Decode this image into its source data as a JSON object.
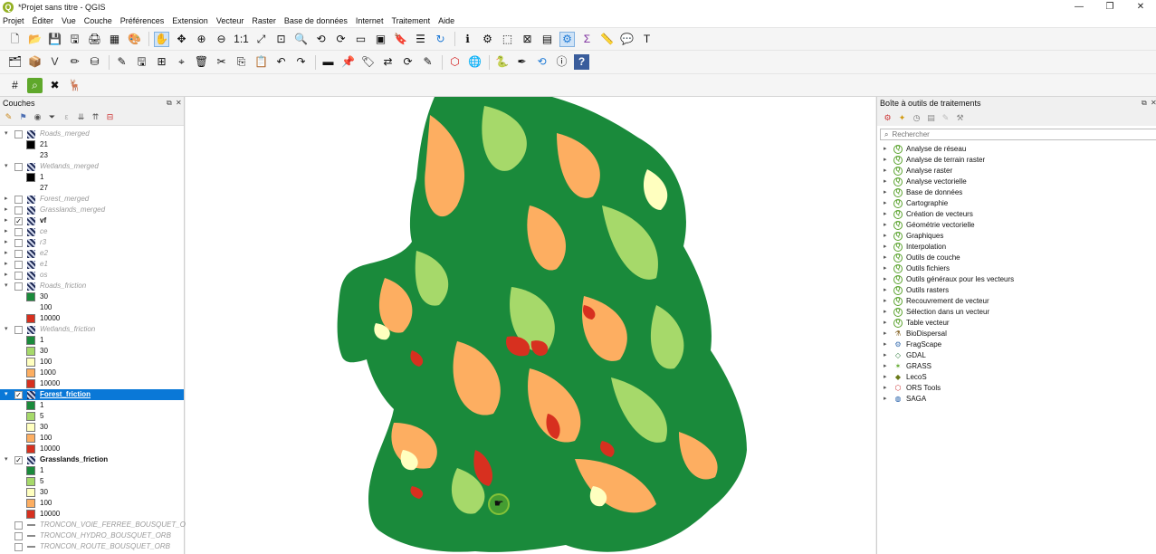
{
  "window": {
    "title": "*Projet sans titre - QGIS",
    "logo_letter": "Q",
    "buttons": [
      "—",
      "❐",
      "✕"
    ]
  },
  "menu": [
    "Projet",
    "Éditer",
    "Vue",
    "Couche",
    "Préférences",
    "Extension",
    "Vecteur",
    "Raster",
    "Base de données",
    "Internet",
    "Traitement",
    "Aide"
  ],
  "toolbars": {
    "row1": [
      "new-icon",
      "open-icon",
      "save-icon",
      "save-as-icon",
      "print-layout-icon",
      "layout-manager-icon",
      "style-manager-icon",
      "sep",
      "pan-icon",
      "pan-selection-icon",
      "zoom-in-icon",
      "zoom-out-icon",
      "zoom-native-icon",
      "zoom-full-icon",
      "zoom-selection-icon",
      "zoom-layer-icon",
      "zoom-last-icon",
      "zoom-next-icon",
      "new-map-view-icon",
      "new-3d-view-icon",
      "bookmark-new-icon",
      "bookmarks-icon",
      "refresh-icon",
      "sep",
      "identify-icon",
      "action-icon",
      "select-icon",
      "deselect-icon",
      "attribute-table-icon",
      "toolbox-icon",
      "statistics-icon",
      "measure-icon",
      "annotation-icon",
      "text-annotation-icon"
    ],
    "row2": [
      "data-source-icon",
      "new-geopackage-icon",
      "digitize-icon",
      "edit-pencil-icon",
      "database-icon",
      "sep",
      "digitize-tools-icon",
      "save-edits-icon",
      "add-feature-icon",
      "node-tool-icon",
      "delete-icon",
      "cut-icon",
      "copy-icon",
      "paste-icon",
      "undo-icon",
      "redo-icon",
      "sep",
      "label-icon",
      "label-pin-icon",
      "label-show-icon",
      "label-move-icon",
      "label-rotate-icon",
      "label-change-icon",
      "sep",
      "shape-icon",
      "globe-icon",
      "sep",
      "python-icon",
      "plugin-pencil-icon",
      "plugin-refresh-icon",
      "plugin-info-icon",
      "help-icon"
    ],
    "row3": [
      "grid-icon",
      "search-map-icon",
      "tools-icon",
      "animal-icon"
    ]
  },
  "layers_panel": {
    "title": "Couches",
    "rows": [
      {
        "kind": "layer",
        "name": "Roads_merged",
        "checked": false,
        "dim": true,
        "expanded": true
      },
      {
        "kind": "class",
        "color": "#000000",
        "label": "21"
      },
      {
        "kind": "class",
        "color": "",
        "label": "23"
      },
      {
        "kind": "layer",
        "name": "Wetlands_merged",
        "checked": false,
        "dim": true,
        "expanded": true
      },
      {
        "kind": "class",
        "color": "#000000",
        "label": "1"
      },
      {
        "kind": "class",
        "color": "",
        "label": "27"
      },
      {
        "kind": "layer",
        "name": "Forest_merged",
        "checked": false,
        "dim": true,
        "expanded": false
      },
      {
        "kind": "layer",
        "name": "Grasslands_merged",
        "checked": false,
        "dim": true,
        "expanded": false
      },
      {
        "kind": "layer",
        "name": "vf",
        "checked": true,
        "dim": false,
        "bold": true,
        "expanded": false
      },
      {
        "kind": "layer",
        "name": "ce",
        "checked": false,
        "dim": true,
        "expanded": false
      },
      {
        "kind": "layer",
        "name": "r3",
        "checked": false,
        "dim": true,
        "expanded": false
      },
      {
        "kind": "layer",
        "name": "e2",
        "checked": false,
        "dim": true,
        "expanded": false
      },
      {
        "kind": "layer",
        "name": "e1",
        "checked": false,
        "dim": true,
        "expanded": false
      },
      {
        "kind": "layer",
        "name": "os",
        "checked": false,
        "dim": true,
        "expanded": false
      },
      {
        "kind": "layer",
        "name": "Roads_friction",
        "checked": false,
        "dim": true,
        "expanded": true
      },
      {
        "kind": "class",
        "color": "#1a8a3b",
        "label": "30"
      },
      {
        "kind": "class",
        "color": "",
        "label": "100"
      },
      {
        "kind": "class",
        "color": "#d7301f",
        "label": "10000"
      },
      {
        "kind": "layer",
        "name": "Wetlands_friction",
        "checked": false,
        "dim": true,
        "expanded": true
      },
      {
        "kind": "class",
        "color": "#1a8a3b",
        "label": "1"
      },
      {
        "kind": "class",
        "color": "#a6d96a",
        "label": "30"
      },
      {
        "kind": "class",
        "color": "#ffffbf",
        "label": "100"
      },
      {
        "kind": "class",
        "color": "#fdae61",
        "label": "1000"
      },
      {
        "kind": "class",
        "color": "#d7301f",
        "label": "10000"
      },
      {
        "kind": "layer",
        "name": "Forest_friction",
        "checked": true,
        "dim": false,
        "selected": true,
        "expanded": true
      },
      {
        "kind": "class",
        "color": "#1a8a3b",
        "label": "1"
      },
      {
        "kind": "class",
        "color": "#a6d96a",
        "label": "5"
      },
      {
        "kind": "class",
        "color": "#ffffbf",
        "label": "30"
      },
      {
        "kind": "class",
        "color": "#fdae61",
        "label": "100"
      },
      {
        "kind": "class",
        "color": "#d7301f",
        "label": "10000"
      },
      {
        "kind": "layer",
        "name": "Grasslands_friction",
        "checked": true,
        "dim": false,
        "bold": true,
        "expanded": true
      },
      {
        "kind": "class",
        "color": "#1a8a3b",
        "label": "1"
      },
      {
        "kind": "class",
        "color": "#a6d96a",
        "label": "5"
      },
      {
        "kind": "class",
        "color": "#ffffbf",
        "label": "30"
      },
      {
        "kind": "class",
        "color": "#fdae61",
        "label": "100"
      },
      {
        "kind": "class",
        "color": "#d7301f",
        "label": "10000"
      },
      {
        "kind": "vlayer",
        "name": "TRONCON_VOIE_FERREE_BOUSQUET_O...",
        "checked": false,
        "dim": true
      },
      {
        "kind": "vlayer",
        "name": "TRONCON_HYDRO_BOUSQUET_ORB",
        "checked": false,
        "dim": true
      },
      {
        "kind": "vlayer",
        "name": "TRONCON_ROUTE_BOUSQUET_ORB",
        "checked": false,
        "dim": true
      }
    ]
  },
  "processing_panel": {
    "title": "Boîte à outils de traitements",
    "search_placeholder": "Rechercher",
    "items": [
      {
        "label": "Analyse de réseau",
        "icon": "qgis-icon"
      },
      {
        "label": "Analyse de terrain raster",
        "icon": "qgis-icon"
      },
      {
        "label": "Analyse raster",
        "icon": "qgis-icon"
      },
      {
        "label": "Analyse vectorielle",
        "icon": "qgis-icon"
      },
      {
        "label": "Base de données",
        "icon": "qgis-icon"
      },
      {
        "label": "Cartographie",
        "icon": "qgis-icon"
      },
      {
        "label": "Création de vecteurs",
        "icon": "qgis-icon"
      },
      {
        "label": "Géométrie vectorielle",
        "icon": "qgis-icon"
      },
      {
        "label": "Graphiques",
        "icon": "qgis-icon"
      },
      {
        "label": "Interpolation",
        "icon": "qgis-icon"
      },
      {
        "label": "Outils de couche",
        "icon": "qgis-icon"
      },
      {
        "label": "Outils fichiers",
        "icon": "qgis-icon"
      },
      {
        "label": "Outils généraux pour les vecteurs",
        "icon": "qgis-icon"
      },
      {
        "label": "Outils rasters",
        "icon": "qgis-icon"
      },
      {
        "label": "Recouvrement de vecteur",
        "icon": "qgis-icon"
      },
      {
        "label": "Sélection dans un vecteur",
        "icon": "qgis-icon"
      },
      {
        "label": "Table vecteur",
        "icon": "qgis-icon"
      },
      {
        "label": "BioDispersal",
        "icon": "biodispersal-icon"
      },
      {
        "label": "FragScape",
        "icon": "fragscape-icon"
      },
      {
        "label": "GDAL",
        "icon": "gdal-icon"
      },
      {
        "label": "GRASS",
        "icon": "grass-icon"
      },
      {
        "label": "LecoS",
        "icon": "lecos-icon"
      },
      {
        "label": "ORS Tools",
        "icon": "ors-icon"
      },
      {
        "label": "SAGA",
        "icon": "saga-icon"
      }
    ]
  },
  "map_colors": {
    "dark_green": "#1a8a3b",
    "light_green": "#a6d96a",
    "pale_yellow": "#ffffbf",
    "orange": "#fdae61",
    "red": "#d7301f",
    "background": "#ffffff"
  }
}
